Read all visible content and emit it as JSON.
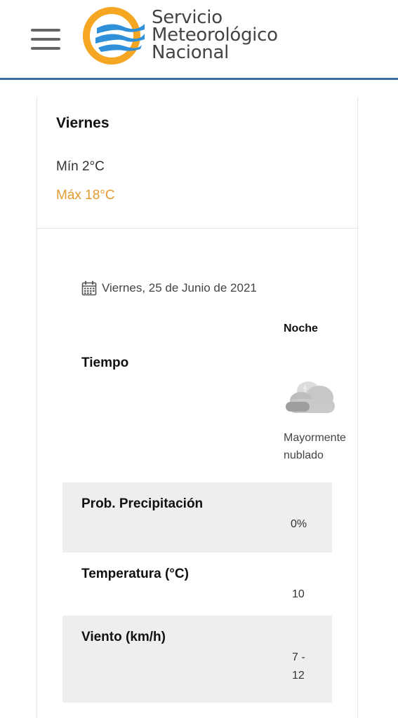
{
  "header": {
    "menu_icon": "hamburger-menu-icon",
    "logo": {
      "line1": "Servicio",
      "line2": "Meteorológico",
      "line3": "Nacional",
      "mark_icon": "smn-logo-mark",
      "colors": {
        "ring": "#f5a623",
        "waves": "#2f8fd8"
      }
    },
    "border_color": "#3b6da6"
  },
  "summary": {
    "day": "Viernes",
    "min": "Mín 2°C",
    "max": "Máx 18°C",
    "max_color": "#e39b2d"
  },
  "forecast": {
    "calendar_icon": "calendar-icon",
    "date": "Viernes, 25 de Junio de 2021",
    "period": "Noche",
    "weather_label": "Tiempo",
    "weather_icon": "mostly-cloudy-night-icon",
    "weather_desc_line1": "Mayormente",
    "weather_desc_line2": "nublado",
    "rows": [
      {
        "label": "Prob. Precipitación",
        "value": "0%"
      },
      {
        "label": "Temperatura (°C)",
        "value": "10"
      },
      {
        "label": "Viento (km/h)",
        "value_line1": "7 -",
        "value_line2": "12"
      }
    ]
  }
}
